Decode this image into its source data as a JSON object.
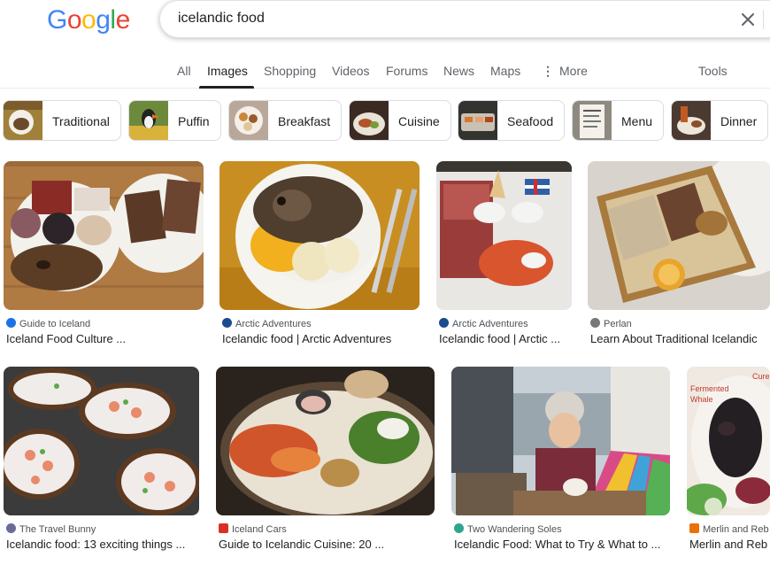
{
  "search": {
    "query": "icelandic food"
  },
  "logo": {
    "letters": [
      "G",
      "o",
      "o",
      "g",
      "l",
      "e"
    ],
    "colors": [
      "#4285F4",
      "#EA4335",
      "#FBBC05",
      "#4285F4",
      "#34A853",
      "#EA4335"
    ]
  },
  "tabs": [
    {
      "label": "All"
    },
    {
      "label": "Images"
    },
    {
      "label": "Shopping"
    },
    {
      "label": "Videos"
    },
    {
      "label": "Forums"
    },
    {
      "label": "News"
    },
    {
      "label": "Maps"
    },
    {
      "label": "More"
    },
    {
      "label": "Tools"
    }
  ],
  "active_tab": "Images",
  "chips": [
    {
      "label": "Traditional"
    },
    {
      "label": "Puffin"
    },
    {
      "label": "Breakfast"
    },
    {
      "label": "Cuisine"
    },
    {
      "label": "Seafood"
    },
    {
      "label": "Menu"
    },
    {
      "label": "Dinner"
    }
  ],
  "results_row1": [
    {
      "source": "Guide to Iceland",
      "title": "Iceland Food Culture ...",
      "source_color": "#1a73e8"
    },
    {
      "source": "Arctic Adventures",
      "title": "Icelandic food | Arctic Adventures",
      "source_color": "#1a4b8c"
    },
    {
      "source": "Arctic Adventures",
      "title": "Icelandic food | Arctic ...",
      "source_color": "#1a4b8c"
    },
    {
      "source": "Perlan",
      "title": "Learn About Traditional Icelandic",
      "source_color": "#777777"
    }
  ],
  "results_row2": [
    {
      "source": "The Travel Bunny",
      "title": "Icelandic food: 13 exciting things ...",
      "source_color": "#6b6b9a"
    },
    {
      "source": "Iceland Cars",
      "title": "Guide to Icelandic Cuisine: 20 ...",
      "source_color": "#d93025"
    },
    {
      "source": "Two Wandering Soles",
      "title": "Icelandic Food: What to Try & What to ...",
      "source_color": "#2fa58f"
    },
    {
      "source": "Merlin and Reb",
      "title": "Merlin and Reb",
      "source_color": "#e8710a"
    }
  ],
  "image_overlay_text": {
    "fermented": "Fermented",
    "whale": "Whale",
    "cured": "Cure"
  },
  "colors": {
    "accent": "#1a73e8",
    "text": "#202124",
    "muted": "#5f6368"
  }
}
